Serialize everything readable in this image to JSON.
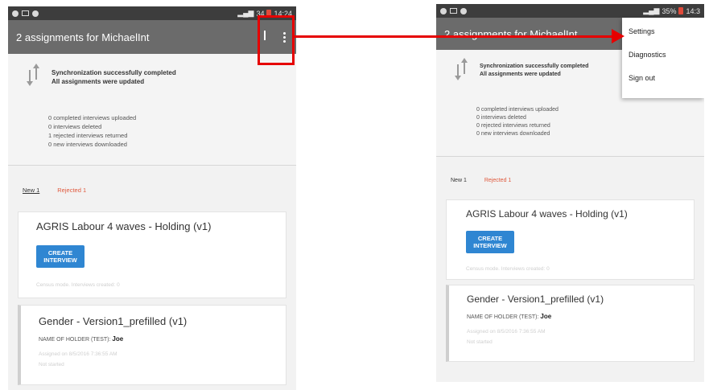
{
  "left_screen": {
    "status": {
      "right_text": "34",
      "time": "14:24"
    },
    "toolbar": {
      "title": "2 assignments for MichaelInt"
    },
    "sync": {
      "line1": "Synchronization successfully completed",
      "line2": "All assignments were updated"
    },
    "stats": [
      "0 completed interviews uploaded",
      "0 interviews deleted",
      "1 rejected interviews returned",
      "0 new interviews downloaded"
    ],
    "tabs": {
      "new": "New 1",
      "rejected": "Rejected 1"
    },
    "card1": {
      "title": "AGRIS Labour 4 waves - Holding (v1)",
      "button": "CREATE\nINTERVIEW",
      "footer": "Census mode. Interviews created: 0"
    },
    "card2": {
      "title": "Gender - Version1_prefilled (v1)",
      "holder_label": "NAME OF HOLDER (TEST):",
      "holder_value": "Joe",
      "assigned": "Assigned on 8/5/2016 7:36:55 AM",
      "status": "Not started"
    }
  },
  "right_screen": {
    "status": {
      "right_text": "35%",
      "time": "14:3"
    },
    "toolbar": {
      "title": "2 assignments for MichaelInt"
    },
    "menu": [
      "Settings",
      "Diagnostics",
      "Sign out"
    ],
    "sync": {
      "line1": "Synchronization successfully completed",
      "line2": "All assignments were updated"
    },
    "stats": [
      "0 completed interviews uploaded",
      "0 interviews deleted",
      "0 rejected interviews returned",
      "0 new interviews downloaded"
    ],
    "tabs": {
      "new": "New 1",
      "rejected": "Rejected 1"
    },
    "card1": {
      "title": "AGRIS Labour 4 waves - Holding (v1)",
      "button": "CREATE\nINTERVIEW",
      "footer": "Census mode. Interviews created: 0"
    },
    "card2": {
      "title": "Gender - Version1_prefilled (v1)",
      "holder_label": "NAME OF HOLDER (TEST):",
      "holder_value": "Joe",
      "assigned": "Assigned on 8/5/2016 7:36:55 AM",
      "status": "Not started"
    }
  },
  "colors": {
    "toolbar": "#6b6b6b",
    "statusbar": "#3d3d3d",
    "accent": "#2f86d2",
    "rejected": "#e0593d",
    "annotation": "#e60000"
  }
}
